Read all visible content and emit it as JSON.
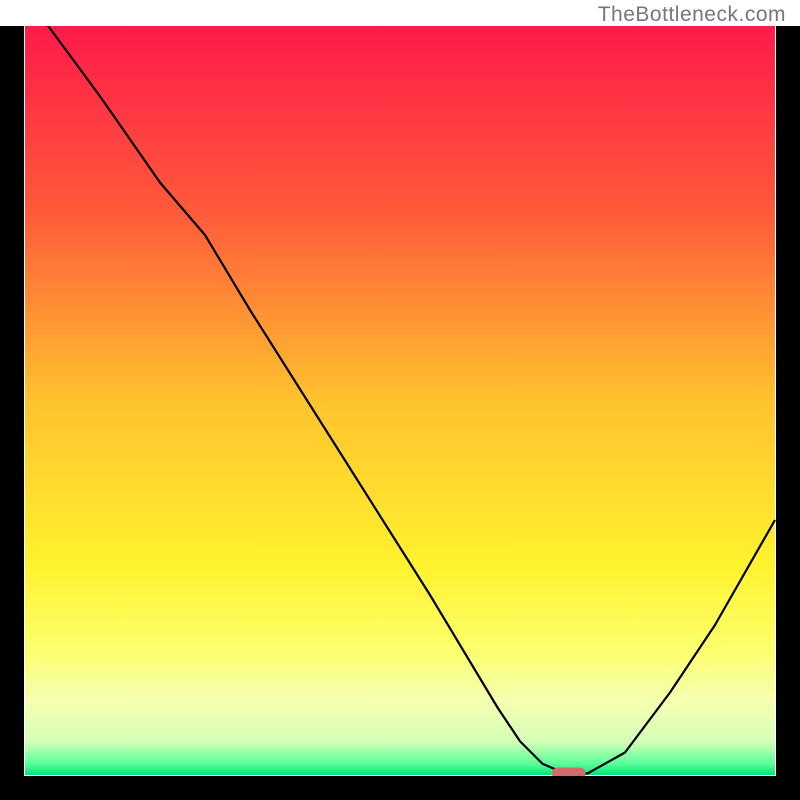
{
  "watermark": "TheBottleneck.com",
  "chart_data": {
    "type": "line",
    "title": "",
    "xlabel": "",
    "ylabel": "",
    "xlim": [
      0,
      100
    ],
    "ylim": [
      0,
      100
    ],
    "axes_visible": false,
    "ticks_visible": false,
    "grid": false,
    "background_gradient": {
      "stops": [
        {
          "offset": 0.0,
          "color": "#ff1a4a"
        },
        {
          "offset": 0.25,
          "color": "#ff5a3a"
        },
        {
          "offset": 0.5,
          "color": "#ffc22e"
        },
        {
          "offset": 0.72,
          "color": "#fff22e"
        },
        {
          "offset": 0.83,
          "color": "#fcff6a"
        },
        {
          "offset": 0.9,
          "color": "#f6ffb0"
        },
        {
          "offset": 0.955,
          "color": "#d6ffb8"
        },
        {
          "offset": 0.985,
          "color": "#5aff9a"
        },
        {
          "offset": 1.0,
          "color": "#00e676"
        }
      ]
    },
    "series": [
      {
        "name": "bottleneck-curve",
        "color": "#000000",
        "stroke_width": 2.2,
        "x": [
          3,
          10,
          18,
          24,
          30,
          36,
          42,
          48,
          54,
          60,
          63,
          66,
          69,
          72,
          75,
          80,
          86,
          92,
          100
        ],
        "y": [
          100,
          90.5,
          79,
          72,
          62,
          52.5,
          43,
          33.5,
          24,
          14,
          9,
          4.5,
          1.5,
          0.2,
          0.2,
          3,
          11,
          20,
          34
        ]
      }
    ],
    "marker": {
      "name": "optimal-point",
      "x": 72.5,
      "y": 0.2,
      "width": 4.5,
      "height": 1.6,
      "color": "#d46a6a",
      "rx": 6
    },
    "frame": {
      "stroke": "#000000",
      "stroke_width": 4
    }
  }
}
